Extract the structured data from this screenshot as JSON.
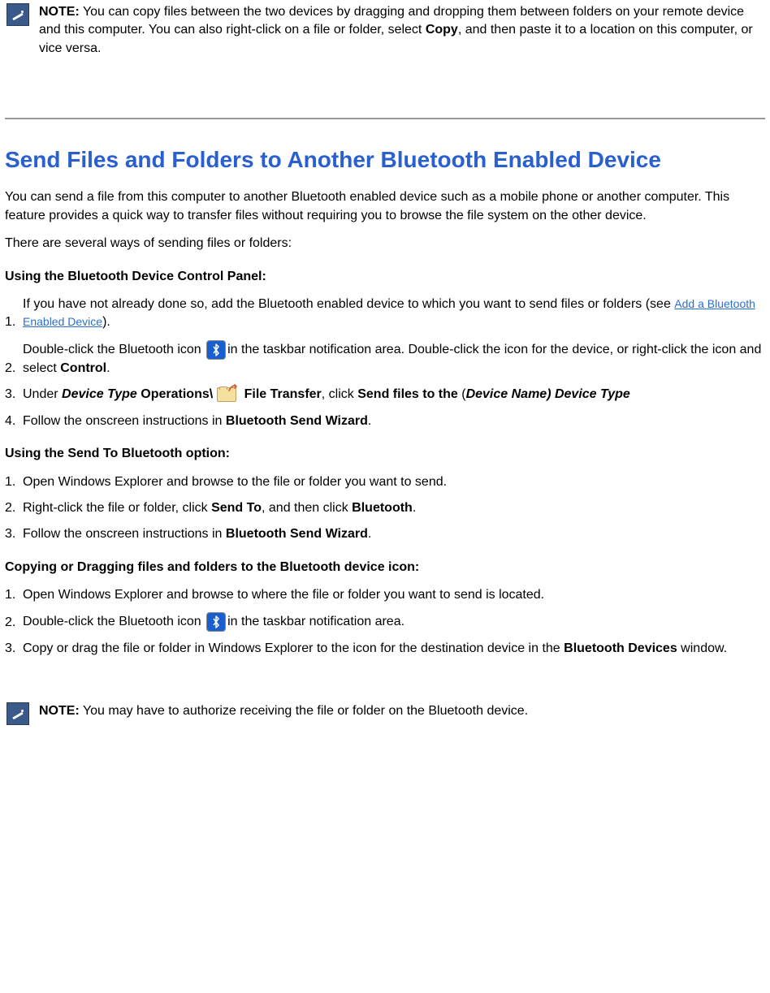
{
  "note1": {
    "label": "NOTE:",
    "text_a": " You can copy files between the two devices by dragging and dropping them between folders on your remote device and this computer. You can also right-click on a file or folder, select ",
    "copy": "Copy",
    "text_b": ", and then paste it to a location on this computer, or vice versa."
  },
  "heading": "Send Files and Folders to Another Bluetooth Enabled Device",
  "intro": "You can send a file from this computer to another Bluetooth enabled device such as a mobile phone or another computer. This feature provides a quick way to transfer files without requiring you to browse the file system on the other device.",
  "intro2": "There are several ways of sending files or folders:",
  "sub1": "Using the Bluetooth Device Control Panel:",
  "s1": {
    "n1": "1.",
    "t1a": "If you have not already done so, add the Bluetooth enabled device to which you want to send files or folders (see ",
    "t1link": "Add a Bluetooth Enabled Device",
    "t1b": ").",
    "n2": "2.",
    "t2a": "Double-click the Bluetooth icon ",
    "t2b": "in the taskbar notification area. Double-click the icon for the device, or right-click the icon and select ",
    "t2c": "Control",
    "t2d": ".",
    "n3": "3.",
    "t3a": "Under ",
    "t3b": "Device Type",
    "t3c": " Operations\\",
    "t3d": " File Transfer",
    "t3e": ", click ",
    "t3f": "Send files to the ",
    "t3g": "(",
    "t3h": "Device Name) Device Type",
    "n4": "4.",
    "t4a": "Follow the onscreen instructions in ",
    "t4b": "Bluetooth Send Wizard",
    "t4c": "."
  },
  "sub2": "Using the Send To Bluetooth option:",
  "s2": {
    "n1": "1.",
    "t1": "Open Windows Explorer and browse to the file or folder you want to send.",
    "n2": "2.",
    "t2a": "Right-click the file or folder, click ",
    "t2b": "Send To",
    "t2c": ", and then click ",
    "t2d": "Bluetooth",
    "t2e": ".",
    "n3": "3.",
    "t3a": "Follow the onscreen instructions in ",
    "t3b": "Bluetooth Send Wizard",
    "t3c": "."
  },
  "sub3": "Copying or Dragging files and folders to the Bluetooth device icon:",
  "s3": {
    "n1": "1.",
    "t1": "Open Windows Explorer and browse to where the file or folder you want to send is located.",
    "n2": "2.",
    "t2a": "Double-click the Bluetooth icon ",
    "t2b": "in the taskbar notification area.",
    "n3": "3.",
    "t3a": "Copy or drag the file or folder in Windows Explorer to the icon for the destination device in the ",
    "t3b": "Bluetooth Devices",
    "t3c": " window."
  },
  "note2": {
    "label": "NOTE:",
    "text": " You may have to authorize receiving the file or folder on the Bluetooth device."
  }
}
